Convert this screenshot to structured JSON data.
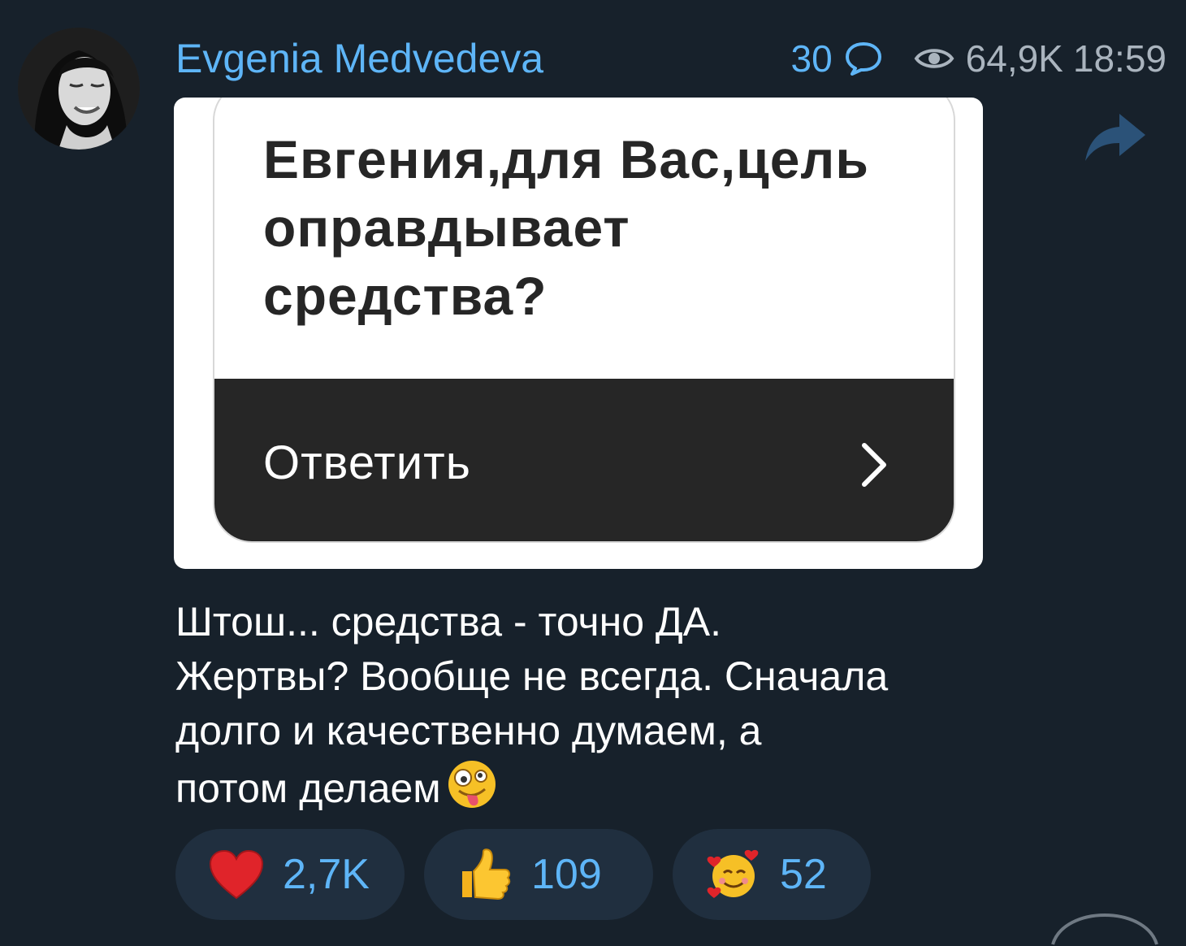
{
  "post": {
    "author": "Evgenia Medvedeva",
    "comments_count": "30",
    "views": "64,9K",
    "time": "18:59"
  },
  "media": {
    "question_lines": [
      "Евгения,для Вас,цель",
      "оправдывает",
      "средства?"
    ],
    "answer_label": "Ответить"
  },
  "message": {
    "lines": [
      "Штош... средства - точно ДА.",
      "Жертвы? Вообще не всегда. Сначала",
      "долго и качественно думаем, а",
      "потом делаем"
    ],
    "trailing_emoji": "zany-face-emoji"
  },
  "reactions": [
    {
      "emoji": "red-heart",
      "count": "2,7K"
    },
    {
      "emoji": "thumbs-up",
      "count": "109"
    },
    {
      "emoji": "smiling-face-with-hearts",
      "count": "52"
    }
  ],
  "colors": {
    "background": "#17212b",
    "accent": "#5eb5f7",
    "meta_text": "#aab4be",
    "reaction_bg": "#202f3f",
    "card_dark": "#262626"
  },
  "icons": {
    "comment": "comment-bubble-icon",
    "views": "eye-icon",
    "share": "share-arrow-icon",
    "chevron": "chevron-right-icon"
  }
}
